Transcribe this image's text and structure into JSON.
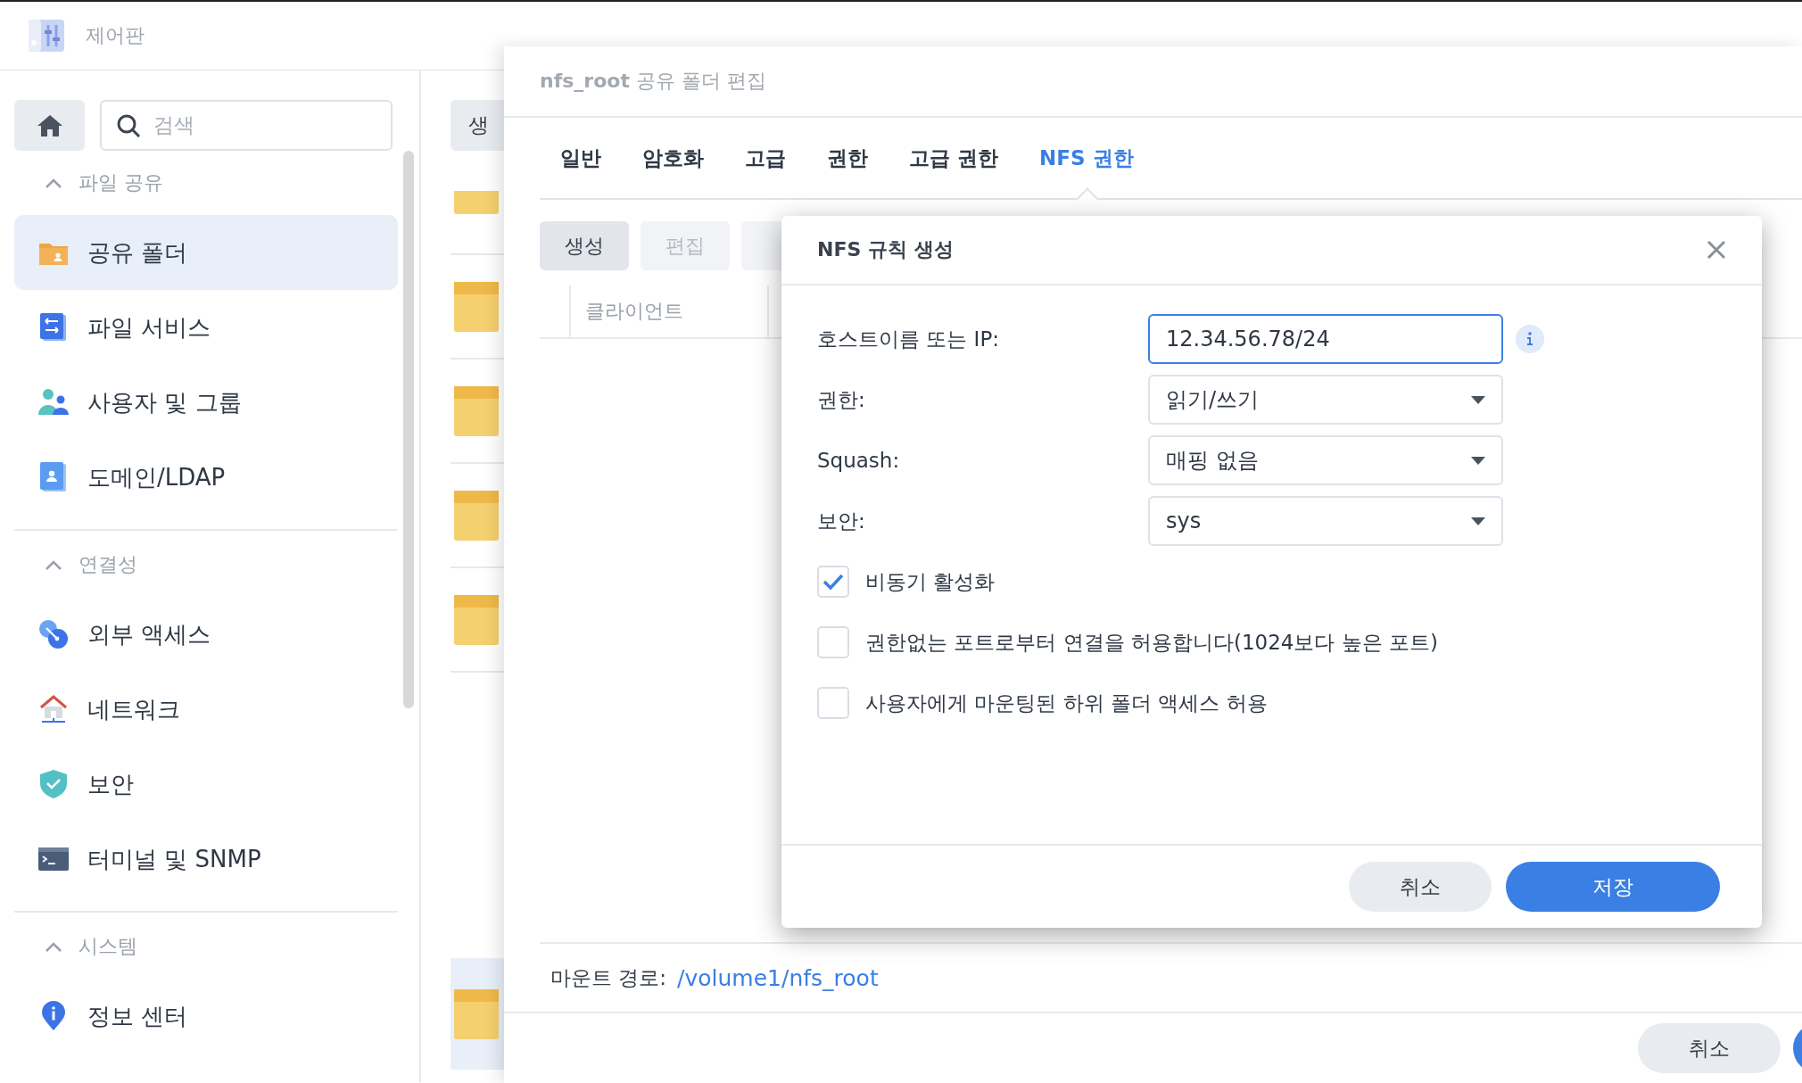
{
  "app": {
    "title": "제어판"
  },
  "search": {
    "placeholder": "검색"
  },
  "sidebar": {
    "sections": [
      {
        "title": "파일 공유",
        "expanded": true,
        "items": [
          {
            "label": "공유 폴더",
            "selected": true
          },
          {
            "label": "파일 서비스",
            "selected": false
          },
          {
            "label": "사용자 및 그룹",
            "selected": false
          },
          {
            "label": "도메인/LDAP",
            "selected": false
          }
        ]
      },
      {
        "title": "연결성",
        "expanded": true,
        "items": [
          {
            "label": "외부 액세스",
            "selected": false
          },
          {
            "label": "네트워크",
            "selected": false
          },
          {
            "label": "보안",
            "selected": false
          },
          {
            "label": "터미널 및 SNMP",
            "selected": false
          }
        ]
      },
      {
        "title": "시스템",
        "expanded": true,
        "items": [
          {
            "label": "정보 센터",
            "selected": false
          }
        ]
      }
    ]
  },
  "background_list": {
    "button": "생",
    "rows": [
      {
        "selected": false
      },
      {
        "selected": false
      },
      {
        "selected": false
      },
      {
        "selected": false
      },
      {
        "selected": false
      },
      {
        "selected": true
      }
    ]
  },
  "editor": {
    "title": "**nfs_root** 공유 폴더 편집",
    "tabs": [
      {
        "label": "일반",
        "selected": false
      },
      {
        "label": "암호화",
        "selected": false
      },
      {
        "label": "고급",
        "selected": false
      },
      {
        "label": "권한",
        "selected": false
      },
      {
        "label": "고급 권한",
        "selected": false
      },
      {
        "label": "NFS 권한",
        "selected": true
      }
    ],
    "toolbar": [
      {
        "label": "생성",
        "disabled": false
      },
      {
        "label": "편집",
        "disabled": true
      },
      {
        "disabled": true
      }
    ],
    "table": {
      "columns": [
        "클라이언트"
      ]
    },
    "mount_path": {
      "label": "마운트 경로:",
      "value": "/volume1/nfs_root"
    },
    "buttons": [
      {
        "label": "취소",
        "kind": "secondary"
      },
      {
        "kind": "primary"
      }
    ]
  },
  "dialog": {
    "title": "NFS 규칙 생성",
    "fields": [
      {
        "label": "호스트이름 또는 IP:",
        "kind": "text",
        "value": "12.34.56.78/24",
        "focused": true,
        "info": true
      },
      {
        "label": "권한:",
        "kind": "select",
        "value": "읽기/쓰기"
      },
      {
        "label": "Squash:",
        "kind": "select",
        "value": "매핑 없음"
      },
      {
        "label": "보안:",
        "kind": "select",
        "value": "sys"
      }
    ],
    "checkboxes": [
      {
        "label": "비동기 활성화",
        "checked": true
      },
      {
        "label": "권한없는 포트로부터 연결을 허용합니다(1024보다 높은 포트)",
        "checked": false
      },
      {
        "label": "사용자에게 마운팅된 하위 폴더 액세스 허용",
        "checked": false
      }
    ],
    "buttons": [
      {
        "label": "취소",
        "kind": "secondary"
      },
      {
        "label": "저장",
        "kind": "primary"
      }
    ]
  }
}
